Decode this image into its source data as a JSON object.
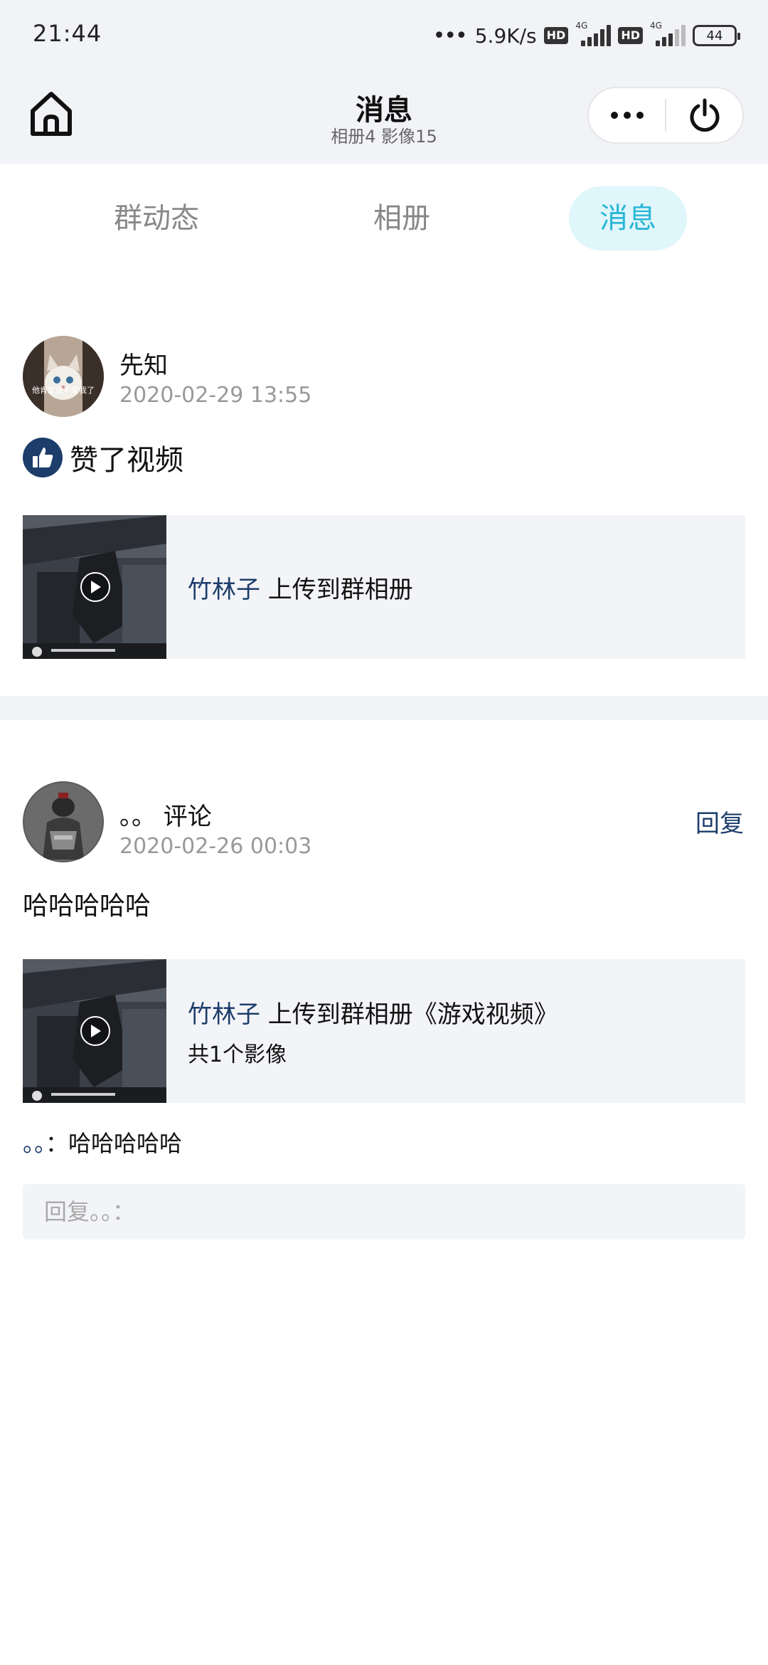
{
  "status_bar": {
    "time": "21:44",
    "net_speed": "5.9K/s",
    "hd1": "HD",
    "hd2": "HD",
    "net1": "4G",
    "net2": "4G",
    "battery": "44"
  },
  "header": {
    "title": "消息",
    "subtitle": "相册4 影像15"
  },
  "tabs": [
    {
      "label": "群动态"
    },
    {
      "label": "相册"
    },
    {
      "label": "消息",
      "active": true
    }
  ],
  "messages": [
    {
      "user": "先知",
      "time": "2020-02-29 13:55",
      "action_text": "赞了视频",
      "avatar_caption": "他肯定是不爱我了",
      "media": {
        "uploader": "竹林子",
        "text": " 上传到群相册"
      }
    },
    {
      "user": "。。 评论",
      "time": "2020-02-26 00:03",
      "reply_label": "回复",
      "body": "哈哈哈哈哈",
      "media": {
        "uploader": "竹林子",
        "text": " 上传到群相册《游戏视频》",
        "count": "共1个影像"
      },
      "comment": {
        "author": "。。",
        "separator": "：",
        "text": "哈哈哈哈哈"
      },
      "reply_placeholder": "回复。。："
    }
  ]
}
